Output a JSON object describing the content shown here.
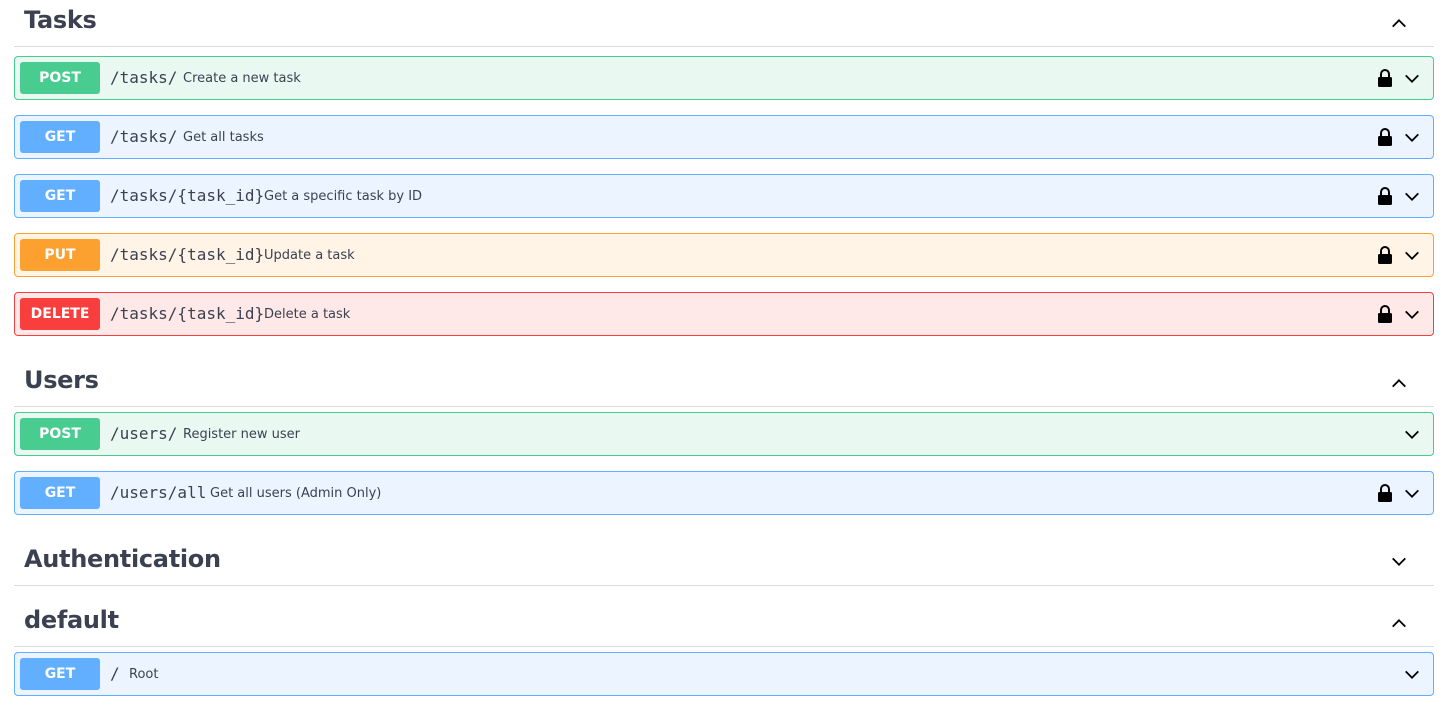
{
  "sections": [
    {
      "title": "Tasks",
      "expanded": true,
      "operations": [
        {
          "method": "POST",
          "path": "/tasks/",
          "summary": "Create a new task",
          "locked": true
        },
        {
          "method": "GET",
          "path": "/tasks/",
          "summary": "Get all tasks",
          "locked": true
        },
        {
          "method": "GET",
          "path": "/tasks/{task_id}",
          "summary": "Get a specific task by ID",
          "locked": true
        },
        {
          "method": "PUT",
          "path": "/tasks/{task_id}",
          "summary": "Update a task",
          "locked": true
        },
        {
          "method": "DELETE",
          "path": "/tasks/{task_id}",
          "summary": "Delete a task",
          "locked": true
        }
      ]
    },
    {
      "title": "Users",
      "expanded": true,
      "operations": [
        {
          "method": "POST",
          "path": "/users/",
          "summary": "Register new user",
          "locked": false
        },
        {
          "method": "GET",
          "path": "/users/all",
          "summary": "Get all users (Admin Only)",
          "locked": true
        }
      ]
    },
    {
      "title": "Authentication",
      "expanded": false,
      "operations": []
    },
    {
      "title": "default",
      "expanded": true,
      "operations": [
        {
          "method": "GET",
          "path": "/",
          "summary": "Root",
          "locked": false
        }
      ]
    }
  ],
  "colors": {
    "post": "#49cc90",
    "get": "#61affe",
    "put": "#fca130",
    "delete": "#f93e3e",
    "text": "#3b4151"
  },
  "icons": {
    "lock": "lock-icon",
    "expand": "chevron-down-icon",
    "collapse": "chevron-up-icon"
  }
}
